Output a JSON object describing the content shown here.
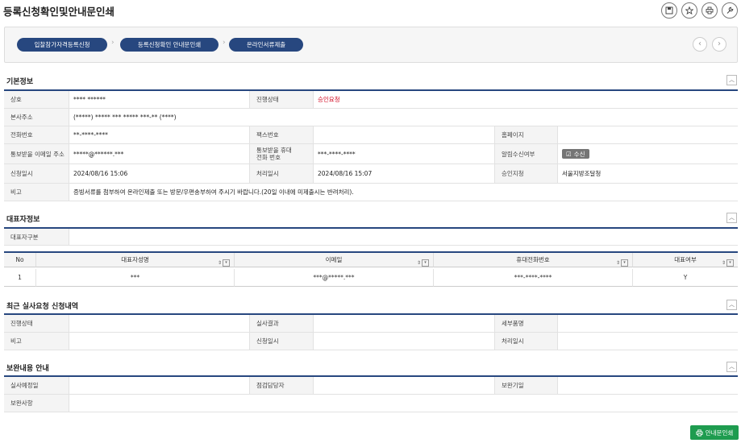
{
  "header": {
    "title": "등록신청확인및안내문인쇄",
    "buttons": [
      {
        "icon": "save-icon"
      },
      {
        "icon": "star-icon"
      },
      {
        "icon": "print-icon"
      },
      {
        "icon": "wrench-icon"
      }
    ]
  },
  "steps": [
    "입찰참가자격등록신청",
    "등록신청확인 안내문인쇄",
    "온라인서류제출"
  ],
  "basic": {
    "title": "기본정보",
    "company_label": "상호",
    "company_value": "**** ******",
    "status_label": "진행상태",
    "status_value": "승인요청",
    "address_label": "본사주소",
    "address_value": "(*****) ***** *** ***** ***-** (****)",
    "phone_label": "전화번호",
    "phone_value": "**-****-****",
    "fax_label": "팩스번호",
    "fax_value": "",
    "homepage_label": "홈페이지",
    "homepage_value": "",
    "email_label": "통보받을 이메일 주소",
    "email_value": "*****@******.***",
    "mobile_label": "통보받을 휴대전화 번호",
    "mobile_value": "***-****-****",
    "alert_label": "알림수신여부",
    "alert_value": "수신",
    "apply_label": "신청일시",
    "apply_value": "2024/08/16 15:06",
    "process_label": "처리일시",
    "process_value": "2024/08/16 15:07",
    "approve_label": "승인지청",
    "approve_value": "서울지방조달청",
    "note_label": "비고",
    "note_value": "증빙서류를 첨부하여 온라인제출 또는 방문/우편송부하여 주시기 바랍니다.(20일 이내에 미제출시는 반려처리)."
  },
  "rep": {
    "title": "대표자정보",
    "type_label": "대표자구분",
    "type_value": "",
    "columns": [
      "No",
      "대표자성명",
      "이메일",
      "휴대전화번호",
      "대표여부"
    ],
    "rows": [
      [
        "1",
        "***",
        "***@*****.***",
        "***-****-****",
        "Y"
      ]
    ]
  },
  "inspect": {
    "title": "최근 실사요청 신청내역",
    "status_label": "진행상태",
    "result_label": "실사결과",
    "item_label": "세부품명",
    "note_label": "비고",
    "apply_label": "신청일시",
    "process_label": "처리일시"
  },
  "supplement": {
    "title": "보완내용 안내",
    "date_label": "실사예정일",
    "manager_label": "점검담당자",
    "deadline_label": "보완기일",
    "item_label": "보완사항"
  },
  "print_button": "안내문인쇄"
}
